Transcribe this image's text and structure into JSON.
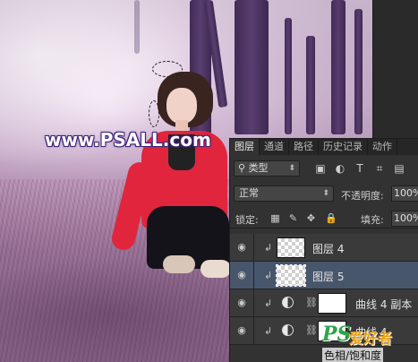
{
  "watermark": "www.PSALL.com",
  "panel": {
    "tabs": [
      {
        "label": "图层",
        "active": true
      },
      {
        "label": "通道",
        "active": false
      },
      {
        "label": "路径",
        "active": false
      },
      {
        "label": "历史记录",
        "active": false
      },
      {
        "label": "动作",
        "active": false
      }
    ],
    "filter": {
      "kind_label": "类型",
      "icons": [
        "image-filter-icon",
        "adjustment-filter-icon",
        "text-filter-icon",
        "shape-filter-icon",
        "smart-object-filter-icon"
      ]
    },
    "blend_mode": "正常",
    "opacity_label": "不透明度:",
    "opacity_value": "100%",
    "lock_label": "锁定:",
    "fill_label": "填充:",
    "fill_value": "100%",
    "layers": [
      {
        "name": "图层 4",
        "thumb": "transparent",
        "clipped": true,
        "adjustment": false,
        "selected": false,
        "visible": true
      },
      {
        "name": "图层 5",
        "thumb": "transparent",
        "clipped": true,
        "adjustment": false,
        "selected": true,
        "visible": true
      },
      {
        "name": "曲线 4 副本",
        "thumb": "white-mask",
        "clipped": true,
        "adjustment": true,
        "selected": false,
        "visible": true
      },
      {
        "name": "曲线 4",
        "thumb": "white-mask",
        "clipped": true,
        "adjustment": true,
        "selected": false,
        "visible": true
      }
    ]
  },
  "logo": {
    "mark": "PS",
    "brand": "爱好者",
    "subtitle": "色相/饱和度"
  }
}
